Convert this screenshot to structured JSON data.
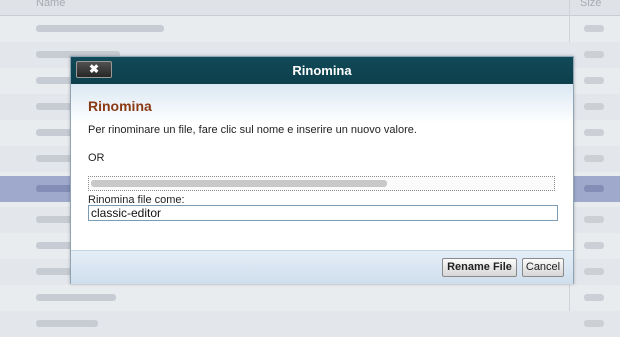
{
  "file_list": {
    "col_name": "Name",
    "col_size": "Size"
  },
  "dialog": {
    "title": "Rinomina",
    "close_label": "✖",
    "heading": "Rinomina",
    "instruction": "Per rinominare un file, fare clic sul nome e inserire un nuovo valore.",
    "or_text": "OR",
    "rename_label": "Rinomina file come:",
    "rename_value": "classic-editor",
    "rename_button": "Rename File",
    "cancel_button": "Cancel"
  }
}
